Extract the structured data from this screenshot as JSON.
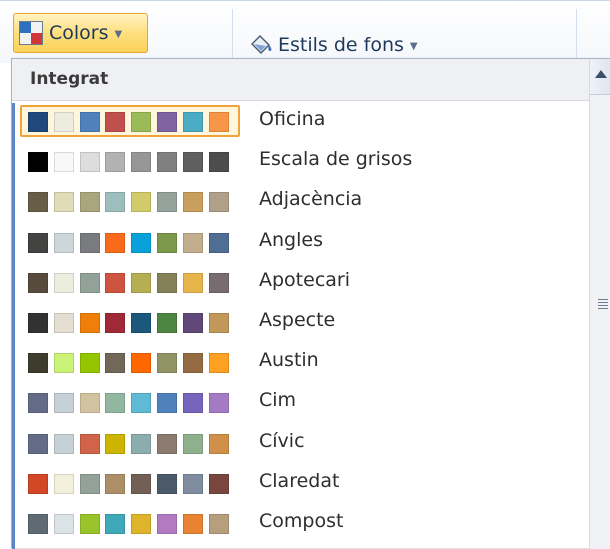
{
  "ribbon": {
    "colors_button": {
      "label": "Colors",
      "icon": "theme-colors-icon"
    },
    "background_styles_button": {
      "label": "Estils de fons",
      "icon": "paint-bucket-icon"
    }
  },
  "gallery": {
    "group_header": "Integrat",
    "selected_index": 0,
    "themes": [
      {
        "name": "Oficina",
        "colors": [
          "#1f497d",
          "#eeece1",
          "#4f81bd",
          "#c0504d",
          "#9bbb59",
          "#8064a2",
          "#4bacc6",
          "#f79646"
        ]
      },
      {
        "name": "Escala de grisos",
        "colors": [
          "#000000",
          "#f8f8f8",
          "#dddddd",
          "#b2b2b2",
          "#969696",
          "#808080",
          "#5f5f5f",
          "#4d4d4d"
        ]
      },
      {
        "name": "Adjacència",
        "colors": [
          "#675e47",
          "#dfdcb7",
          "#a9a57c",
          "#9cbebd",
          "#d2cb6c",
          "#95a39d",
          "#c89f5d",
          "#b1a089"
        ]
      },
      {
        "name": "Angles",
        "colors": [
          "#434342",
          "#cdd7d9",
          "#797b7e",
          "#f96a1b",
          "#08a1d9",
          "#7c984a",
          "#c2ad8d",
          "#506e94"
        ]
      },
      {
        "name": "Apotecari",
        "colors": [
          "#564b3c",
          "#ebeddf",
          "#93a299",
          "#cf543f",
          "#b5ae53",
          "#848058",
          "#e8b54d",
          "#786c71"
        ]
      },
      {
        "name": "Aspecte",
        "colors": [
          "#323232",
          "#e3ded1",
          "#f07f09",
          "#9f2936",
          "#1b587c",
          "#4e8542",
          "#604878",
          "#c19859"
        ]
      },
      {
        "name": "Austin",
        "colors": [
          "#3e3d2d",
          "#caf278",
          "#94c600",
          "#71685a",
          "#ff6700",
          "#909465",
          "#956b43",
          "#fea022"
        ]
      },
      {
        "name": "Cim",
        "colors": [
          "#646b86",
          "#c5d1d7",
          "#d1c39f",
          "#91b7a1",
          "#5fbbd5",
          "#4f81bd",
          "#7764bc",
          "#a57ac4"
        ]
      },
      {
        "name": "Cívic",
        "colors": [
          "#646b86",
          "#c5d1d7",
          "#d16349",
          "#ccb400",
          "#8cadae",
          "#8c7b70",
          "#8fb08c",
          "#d19049"
        ]
      },
      {
        "name": "Claredat",
        "colors": [
          "#d24726",
          "#f2f2dc",
          "#93a299",
          "#ad8f67",
          "#726056",
          "#4c5a6a",
          "#808da0",
          "#79463d"
        ]
      },
      {
        "name": "Compost",
        "colors": [
          "#5e6b73",
          "#dce3e5",
          "#9ac42b",
          "#3fa9b9",
          "#ddb42b",
          "#b47ac1",
          "#e98232",
          "#b59f7c"
        ]
      }
    ]
  },
  "scrollbar": {
    "up_icon": "scroll-up-arrow-icon",
    "grip_icon": "scroll-grip-icon"
  }
}
